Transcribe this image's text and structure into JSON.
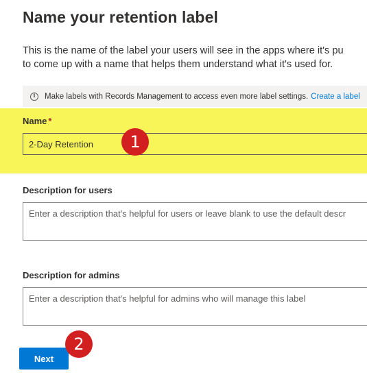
{
  "page": {
    "title": "Name your retention label",
    "intro_line1": "This is the name of the label your users will see in the apps where it's pu",
    "intro_line2": "to come up with a name that helps them understand what it's used for."
  },
  "info_bar": {
    "icon": "info-icon",
    "text": "Make labels with Records Management to access even more label settings.",
    "link": "Create a label"
  },
  "name_field": {
    "label": "Name",
    "required_marker": "*",
    "value": "2-Day Retention",
    "highlight_color": "#f8f558"
  },
  "description_users": {
    "label": "Description for users",
    "placeholder": "Enter a description that's helpful for users or leave blank to use the default descr"
  },
  "description_admins": {
    "label": "Description for admins",
    "placeholder": "Enter a description that's helpful for admins who will manage this label"
  },
  "annotations": {
    "badge1": "1",
    "badge2": "2",
    "badge_color": "#d21f1f"
  },
  "actions": {
    "next_label": "Next",
    "accent_color": "#0078d4"
  }
}
